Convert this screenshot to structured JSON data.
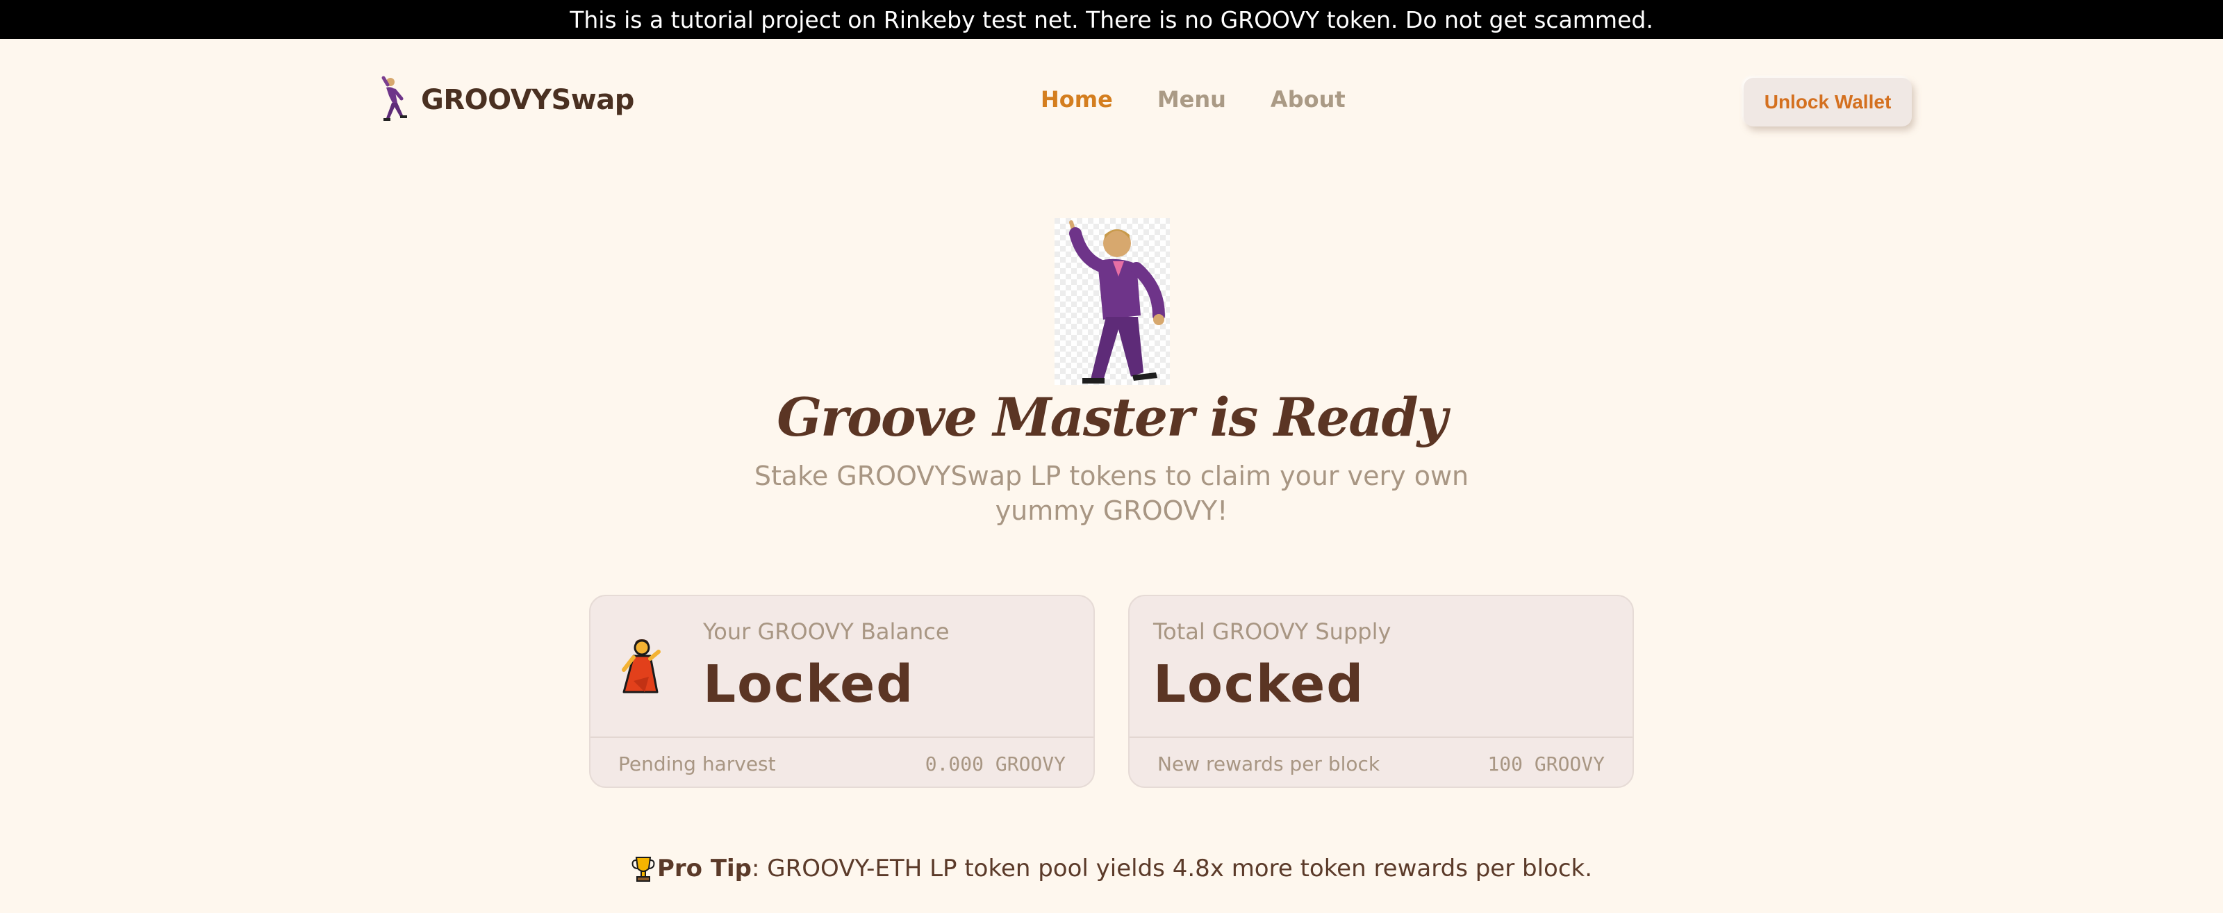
{
  "banner": {
    "text": "This is a tutorial project on Rinkeby test net. There is no GROOVY token. Do not get scammed."
  },
  "header": {
    "logo_text": "GROOVYSwap",
    "nav": [
      {
        "label": "Home",
        "active": true
      },
      {
        "label": "Menu",
        "active": false
      },
      {
        "label": "About",
        "active": false
      }
    ],
    "unlock_label": "Unlock Wallet"
  },
  "hero": {
    "title": "Groove Master is Ready",
    "subtitle": "Stake GROOVYSwap LP tokens to claim your very own yummy GROOVY!"
  },
  "cards": {
    "balance": {
      "label": "Your GROOVY Balance",
      "value": "Locked",
      "footer_label": "Pending harvest",
      "footer_value": "0.000 GROOVY"
    },
    "supply": {
      "label": "Total GROOVY Supply",
      "value": "Locked",
      "footer_label": "New rewards per block",
      "footer_value": "100 GROOVY"
    }
  },
  "protip": {
    "prefix": "Pro Tip",
    "text": ": GROOVY-ETH LP token pool yields 4.8x more token rewards per block."
  },
  "icons": {
    "logo": "dancing-man-icon",
    "hero": "dancing-man-icon",
    "balance": "dancing-woman-icon",
    "protip": "trophy-icon"
  },
  "colors": {
    "background": "#fef7ee",
    "accent": "#d47e1f",
    "title": "#5b3524",
    "muted": "#a89683",
    "card": "#f3e9e6"
  }
}
